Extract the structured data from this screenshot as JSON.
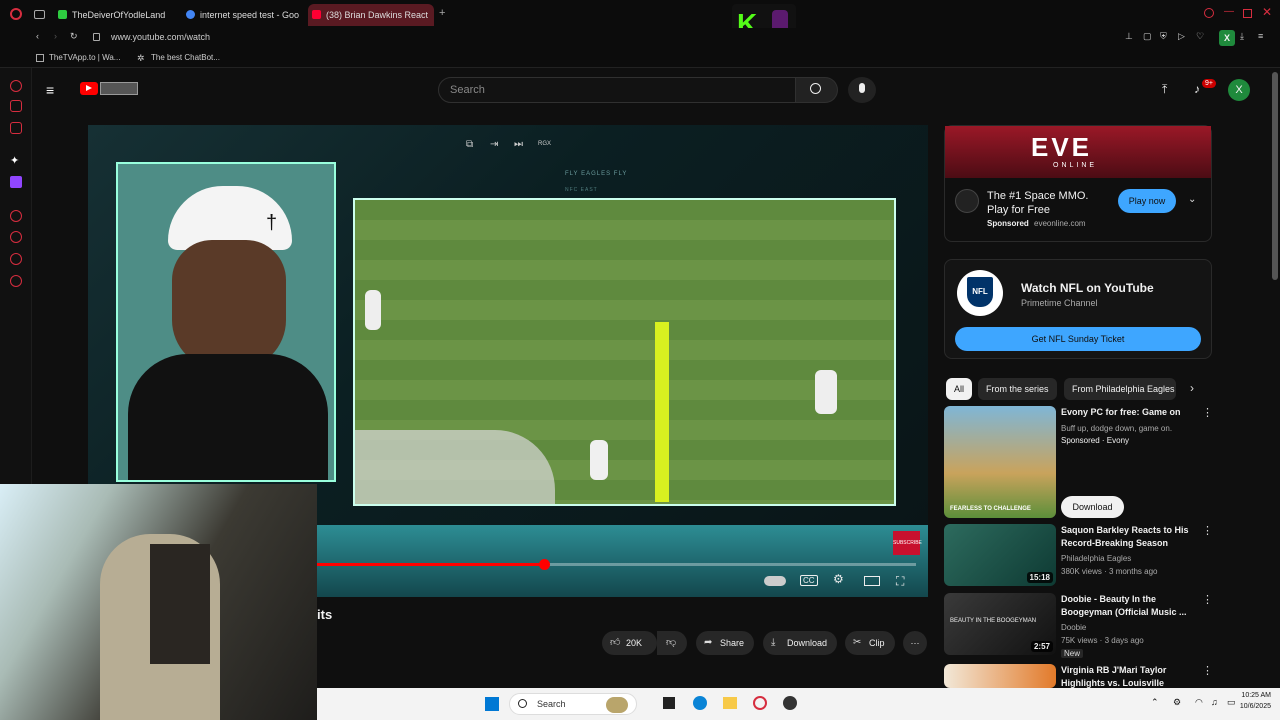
{
  "browser": {
    "tabs": [
      {
        "title": "TheDeiverOfYodleLand",
        "color": "#2ecc40"
      },
      {
        "title": "internet speed test - Goo",
        "color": "#4285f4"
      },
      {
        "title": "(38) Brian Dawkins React",
        "color": "#ff0033"
      }
    ],
    "url": "www.youtube.com/watch",
    "bookmarks": [
      "TheTVApp.to | Wa...",
      "The best ChatBot..."
    ],
    "profile_initial": "X"
  },
  "youtube": {
    "search_placeholder": "Search",
    "notification_badge": "9+",
    "avatar_initial": "X",
    "title_fragment": "its",
    "video_overlay_text": "FLY EAGLES FLY",
    "video_overlay_sub": "NFC EAST",
    "subscribe_stamp": "SUBSCRIBE",
    "progress_fraction": 0.38,
    "actions": {
      "likes": "20K",
      "share": "Share",
      "download": "Download",
      "clip": "Clip"
    }
  },
  "sidebar": {
    "eve_ad": {
      "brand": "EVE",
      "brand_sub": "ONLINE",
      "title": "The #1 Space MMO. Play for Free",
      "sponsored": "Sponsored",
      "domain": "eveonline.com",
      "cta": "Play now"
    },
    "nfl_card": {
      "title": "Watch NFL on YouTube",
      "subtitle": "Primetime Channel",
      "cta": "Get NFL Sunday Ticket",
      "logo_text": "NFL"
    },
    "chips": [
      "All",
      "From the series",
      "From Philadelphia Eagles"
    ],
    "recommendations": [
      {
        "title": "Evony PC for free: Game on",
        "line2": "Buff up, dodge down, game on.",
        "line3": "Sponsored · Evony",
        "duration": "",
        "button": "Download",
        "thumb_text": "FEARLESS TO CHALLENGE"
      },
      {
        "title": "Saquon Barkley Reacts to His Record-Breaking Season",
        "line2": "Philadelphia Eagles",
        "line3": "380K views · 3 months ago",
        "duration": "15:18"
      },
      {
        "title": "Doobie - Beauty In the Boogeyman (Official Music ...",
        "line2": "Doobie",
        "line3": "75K views · 3 days ago",
        "badge": "New",
        "duration": "2:57",
        "thumb_text": "BEAUTY IN THE BOOGEYMAN"
      },
      {
        "title": "Virginia RB J'Mari Taylor Highlights vs. Louisville",
        "line2": "",
        "line3": "",
        "duration": ""
      }
    ]
  },
  "taskbar": {
    "search": "Search",
    "time": "10:25 AM",
    "date": "10/6/2025"
  },
  "colors": {
    "youtube_red": "#ff0000",
    "cta_blue": "#3ea6ff",
    "opera_red": "#d62d3f"
  }
}
